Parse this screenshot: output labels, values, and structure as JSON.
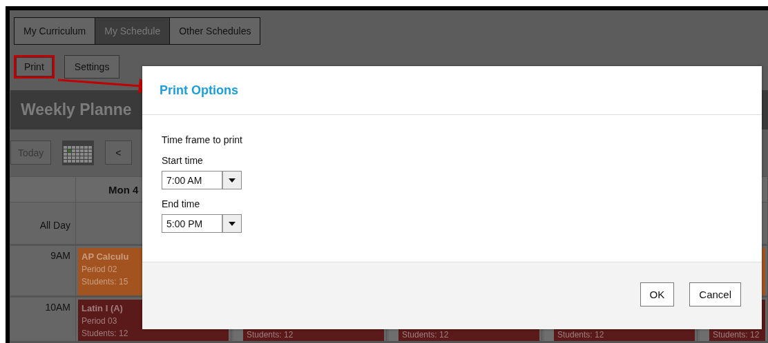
{
  "tabs": [
    {
      "label": "My Curriculum",
      "selected": false
    },
    {
      "label": "My Schedule",
      "selected": true
    },
    {
      "label": "Other Schedules",
      "selected": false
    }
  ],
  "actions": [
    {
      "label": "Print",
      "highlighted": true
    },
    {
      "label": "Settings",
      "highlighted": false
    }
  ],
  "planner": {
    "title": "Weekly Planne",
    "today_button": "Today",
    "prev_button": "<",
    "day_headers": [
      "Mon 4"
    ],
    "rows": [
      {
        "label": "All Day",
        "cells": [
          {
            "kind": "empty"
          },
          {
            "kind": "empty"
          },
          {
            "kind": "empty"
          },
          {
            "kind": "empty"
          },
          {
            "kind": "empty"
          }
        ]
      },
      {
        "label": "9AM",
        "cells": [
          {
            "kind": "event",
            "color": "#a3531f",
            "title": "AP Calculu",
            "lines": [
              "Period 02",
              "Students: 15"
            ]
          },
          {
            "kind": "empty"
          },
          {
            "kind": "empty"
          },
          {
            "kind": "empty"
          },
          {
            "kind": "event",
            "color": "#a3531f"
          }
        ]
      },
      {
        "label": "10AM",
        "cells": [
          {
            "kind": "event",
            "color": "#5a1a1a",
            "title": "Latin I (A)",
            "lines": [
              "Period 03",
              "Students: 12"
            ]
          },
          {
            "kind": "event",
            "color": "#5a1a1a",
            "lines": [
              "Students: 12"
            ]
          },
          {
            "kind": "event",
            "color": "#5a1a1a",
            "lines": [
              "Students: 12"
            ]
          },
          {
            "kind": "event",
            "color": "#5a1a1a",
            "lines": [
              "Students: 12"
            ]
          },
          {
            "kind": "event",
            "color": "#5a1a1a",
            "lines": [
              "Students: 12"
            ]
          }
        ]
      }
    ]
  },
  "dialog": {
    "title": "Print Options",
    "section_label": "Time frame to print",
    "fields": [
      {
        "label": "Start time",
        "value": "7:00 AM"
      },
      {
        "label": "End time",
        "value": "5:00 PM"
      }
    ],
    "buttons": [
      "OK",
      "Cancel"
    ]
  }
}
